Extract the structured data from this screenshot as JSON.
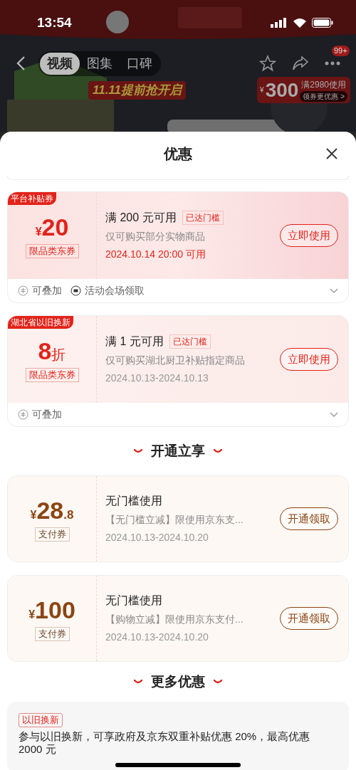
{
  "status_bar": {
    "time": "13:54"
  },
  "nav": {
    "tabs": [
      {
        "label": "视频",
        "selected": true
      },
      {
        "label": "图集",
        "selected": false
      },
      {
        "label": "口碑",
        "selected": false
      }
    ],
    "badge": "99+"
  },
  "promo": {
    "banner": "11.11提前抢开启",
    "currency": "¥",
    "amount": "300",
    "condition": "满2980使用",
    "link": "领券更优惠 >"
  },
  "sheet": {
    "title": "优惠"
  },
  "coupons": [
    {
      "kind": "platform",
      "corner_tag": "平台补贴券",
      "currency": "¥",
      "amount": "20",
      "tag": "限品类东券",
      "title": "满 200 元可用",
      "badge": "已达门槛",
      "desc": "仅可购买部分实物商品",
      "date": "2024.10.14 20:00 可用",
      "date_highlight": true,
      "button": "立即使用",
      "footer": [
        {
          "kind": "stack",
          "label": "可叠加"
        },
        {
          "kind": "venue",
          "label": "活动会场领取"
        }
      ]
    },
    {
      "kind": "regional",
      "corner_tag": "湖北省以旧换新",
      "amount": "8",
      "unit": "折",
      "tag": "限品类东券",
      "title": "满 1 元可用",
      "badge": "已达门槛",
      "desc": "仅可购买湖北厨卫补贴指定商品",
      "date": "2024.10.13-2024.10.13",
      "date_highlight": false,
      "button": "立即使用",
      "footer": [
        {
          "kind": "stack",
          "label": "可叠加"
        }
      ]
    }
  ],
  "sections": [
    {
      "title": "开通立享",
      "coupons": [
        {
          "kind": "payment",
          "currency": "¥",
          "amount": "28",
          "decimal": ".8",
          "tag": "支付券",
          "title": "无门槛使用",
          "desc": "【无门槛立减】限使用京东支...",
          "date": "2024.10.13-2024.10.20",
          "date_highlight": false,
          "button": "开通领取"
        },
        {
          "kind": "payment",
          "currency": "¥",
          "amount": "100",
          "tag": "支付券",
          "title": "无门槛使用",
          "desc": "【购物立减】限使用京东支付...",
          "date": "2024.10.13-2024.10.20",
          "date_highlight": false,
          "button": "开通领取"
        }
      ]
    },
    {
      "title": "更多优惠",
      "offer": {
        "tag": "以旧换新",
        "text": "参与以旧换新，可享政府及京东双重补贴优惠 20%，最高优惠 2000 元"
      }
    }
  ]
}
